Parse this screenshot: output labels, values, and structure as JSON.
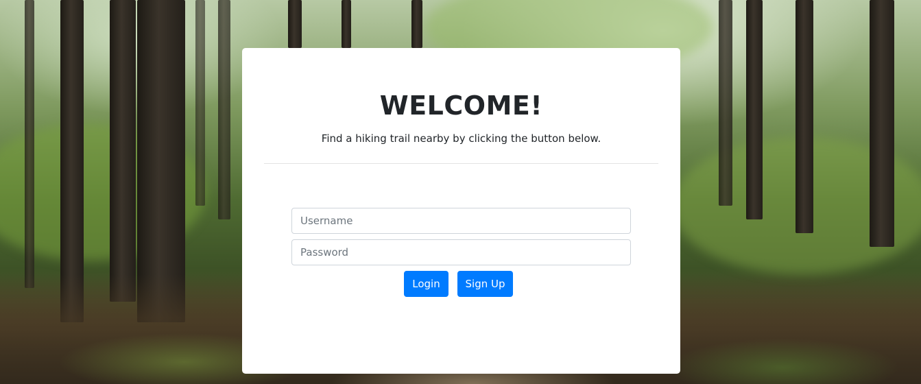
{
  "card": {
    "title": "WELCOME!",
    "subtitle": "Find a hiking trail nearby by clicking the button below."
  },
  "form": {
    "username": {
      "value": "",
      "placeholder": "Username"
    },
    "password": {
      "value": "",
      "placeholder": "Password"
    },
    "login_label": "Login",
    "signup_label": "Sign Up"
  },
  "colors": {
    "primary_button": "#007bff",
    "card_background": "#ffffff",
    "heading_text": "#212529"
  }
}
